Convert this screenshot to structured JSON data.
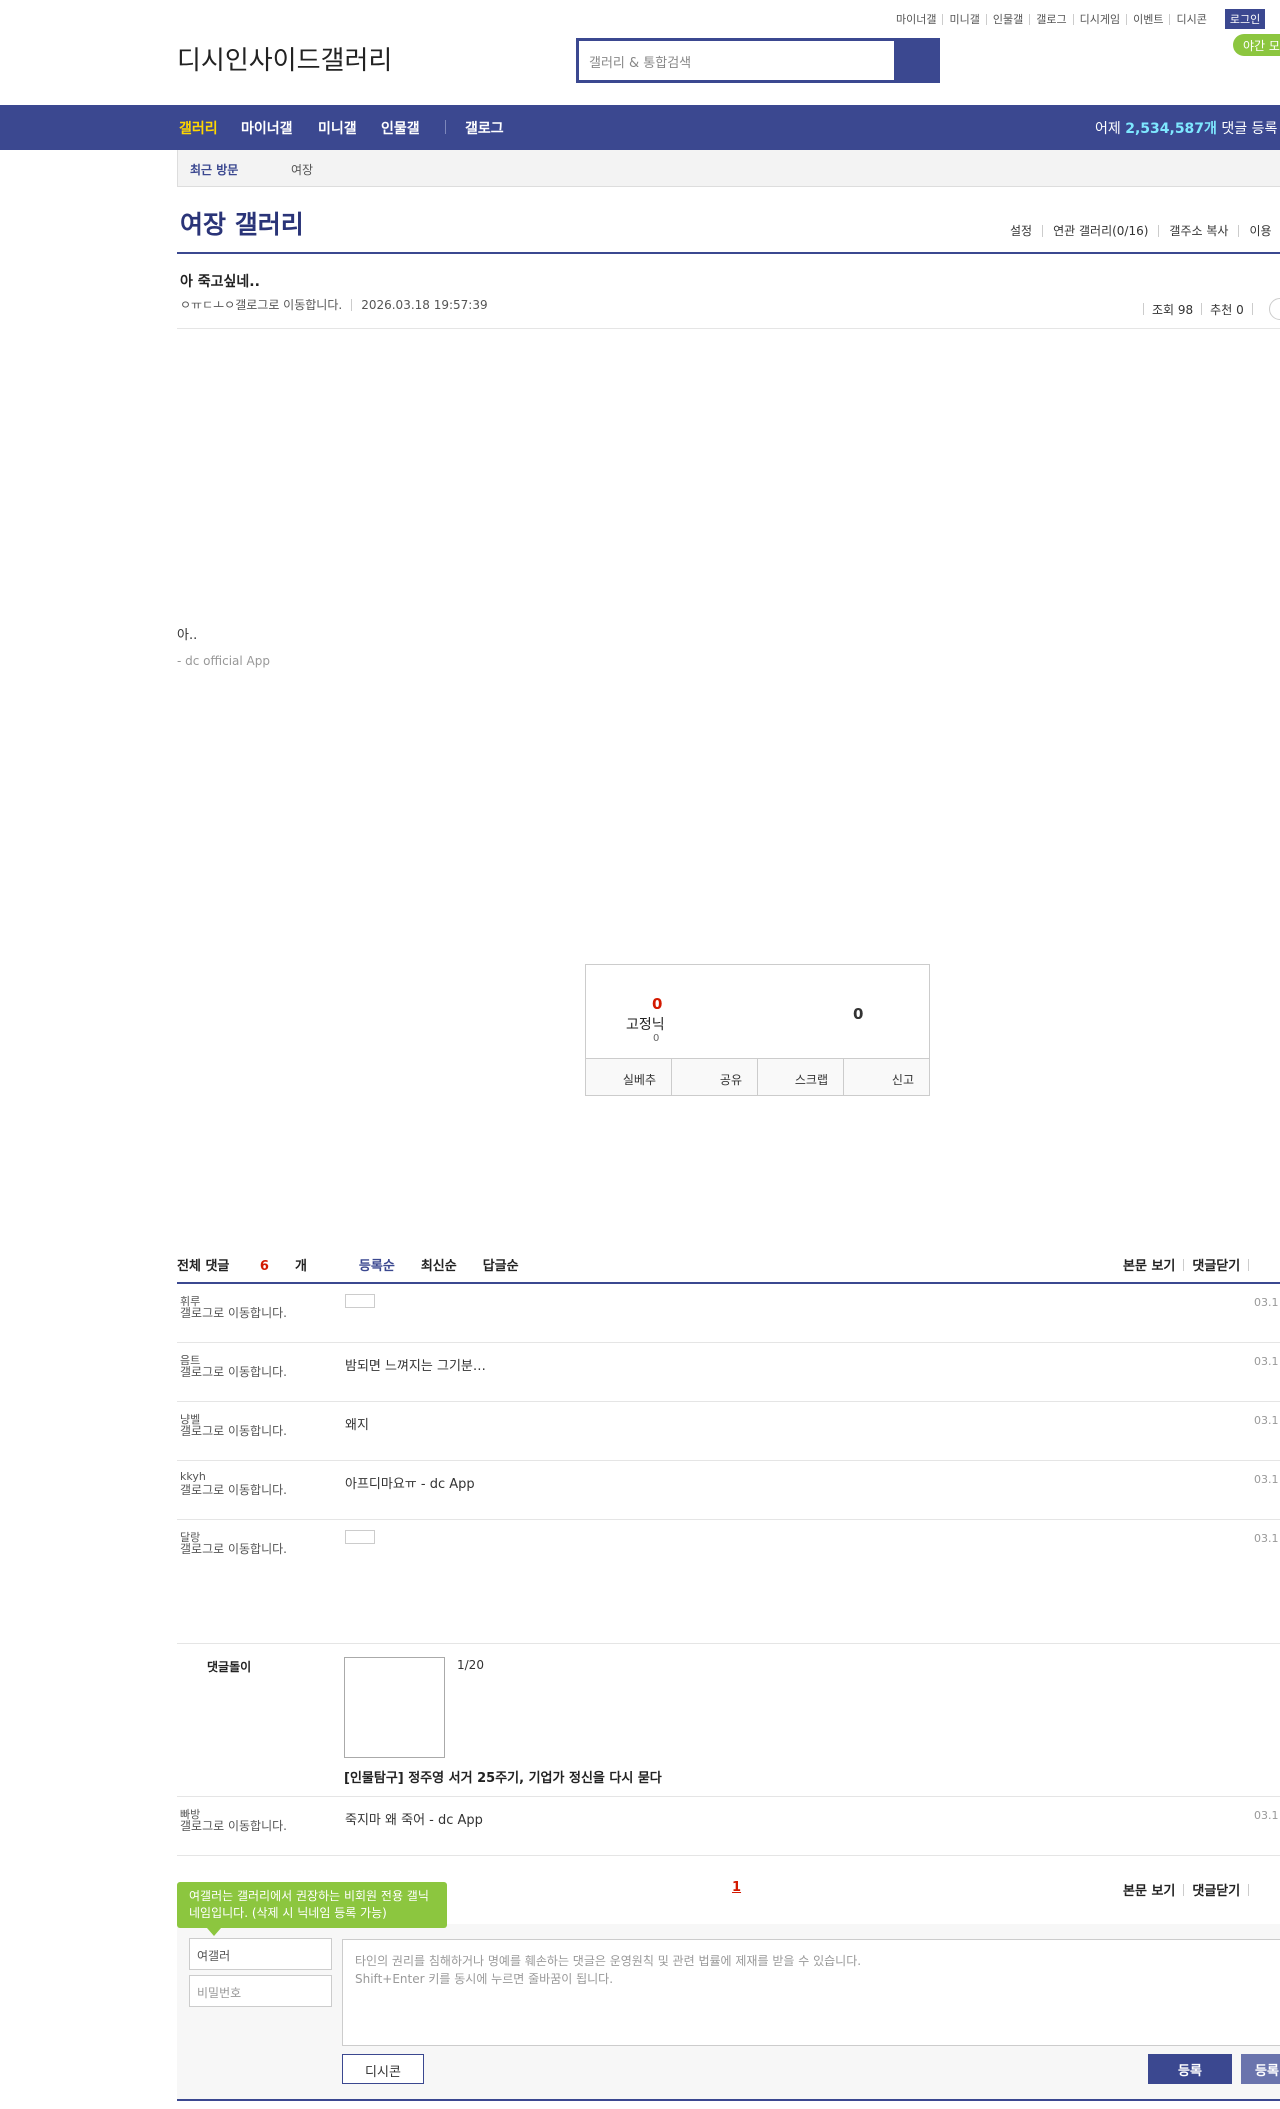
{
  "header": {
    "top_links": [
      "마이너갤",
      "미니갤",
      "인물갤",
      "갤로그",
      "디시게임",
      "이벤트",
      "디시콘"
    ],
    "login": "로그인",
    "logo_alt": "디시인사이드갤러리",
    "search_placeholder": "갤러리 & 통합검색",
    "night_mode": "야간 모드"
  },
  "nav": {
    "items": [
      "갤러리",
      "마이너갤",
      "미니갤",
      "인물갤",
      "갤로그"
    ],
    "stat_prefix": "어제",
    "stat_count": "2,534,587개",
    "stat_suffix": "댓글 등록"
  },
  "recent": {
    "label": "최근 방문",
    "gallery": "여장"
  },
  "gallery": {
    "title": "여장 갤러리",
    "menu": [
      "설정",
      "연관 갤러리(0/16)",
      "갤주소 복사",
      "이용"
    ]
  },
  "post": {
    "title": "아 죽고싶네..",
    "author": "ㅇㅠㄷㅗㅇ",
    "gallog_alt": "갤로그로 이동합니다.",
    "date": "2026.03.18 19:57:39",
    "views": "조회 98",
    "recommend": "추천 0",
    "body_text": "아..",
    "signature": "- dc official App"
  },
  "vote": {
    "up": "0",
    "fixed_nick_alt": "고정닉",
    "fixed_nick_count": "0",
    "down": "0",
    "buttons": [
      "실베추",
      "공유",
      "스크랩",
      "신고"
    ]
  },
  "comments": {
    "total_label": "전체 댓글",
    "total_count": "6",
    "total_unit": "개",
    "sort_tabs": [
      "등록순",
      "최신순",
      "답글순"
    ],
    "view_post": "본문 보기",
    "close_comments": "댓글닫기",
    "rows": [
      {
        "nick": "휘루",
        "text": "",
        "date": "03.1",
        "image": true
      },
      {
        "nick": "음트",
        "text": "밤되면 느껴지는 그기분…",
        "date": "03.1",
        "image": false
      },
      {
        "nick": "냥벨",
        "text": "왜지",
        "date": "03.1",
        "image": false
      },
      {
        "nick": "kkyh",
        "text": "아프디마요ㅠ - dc App",
        "date": "03.1",
        "image": false
      },
      {
        "nick": "달랑",
        "text": "",
        "date": "03.1",
        "image": true
      },
      {
        "nick": "빠방",
        "text": "죽지마 왜 죽어 - dc App",
        "date": "03.1",
        "image": false
      }
    ],
    "gallog_alt": "갤로그로 이동합니다.",
    "dolli_label": "댓글돌이",
    "dolli_count": "1/20",
    "dolli_title": "[인물탐구] 정주영 서거 25주기, 기업가 정신을 다시 묻다",
    "page": "1"
  },
  "write": {
    "tip": "여갤러는 갤러리에서 권장하는 비회원 전용 갤닉네임입니다. (삭제 시 닉네임 등록 가능)",
    "nick_value": "여갤러",
    "password_placeholder": "비밀번호",
    "textarea_line1": "타인의 권리를 침해하거나 명예를 훼손하는 댓글은 운영원칙 및 관련 법률에 제재를 받을 수 있습니다.",
    "textarea_line2": "Shift+Enter 키를 동시에 누르면 줄바꿈이 됩니다.",
    "dccon": "디시콘",
    "submit": "등록",
    "submit2": "등록"
  },
  "colors": {
    "primary": "#3b4890",
    "accent_red": "#d31900",
    "green": "#8cc63f",
    "nav_active": "#ffd700"
  }
}
